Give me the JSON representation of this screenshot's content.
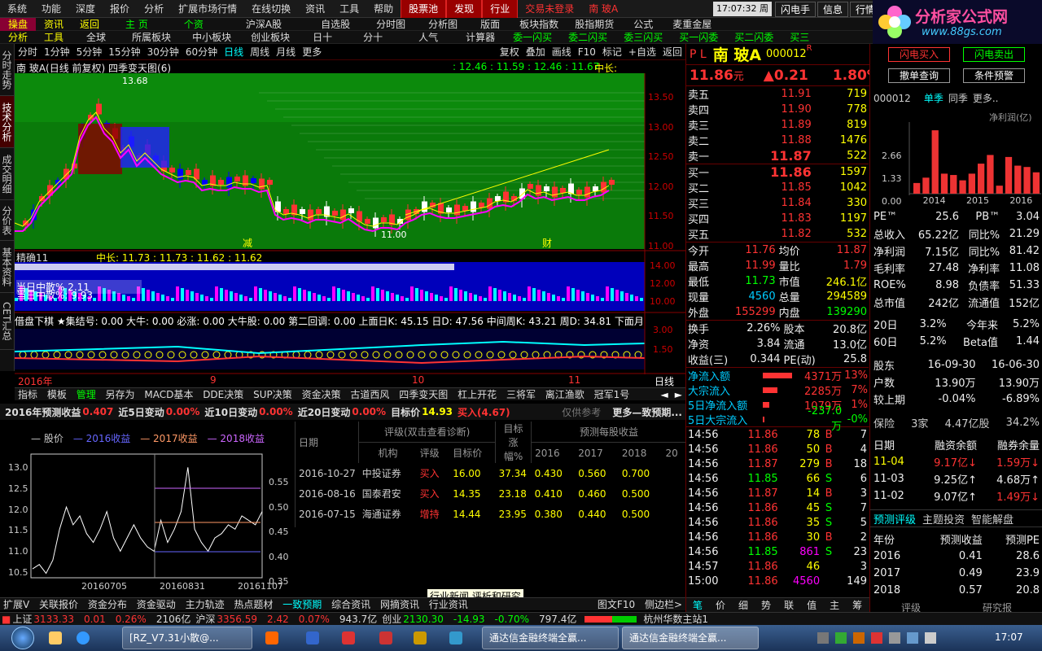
{
  "menu": {
    "items": [
      "系统",
      "功能",
      "深度",
      "报价",
      "分析",
      "扩展市场行情",
      "在线切换",
      "资讯",
      "工具",
      "帮助"
    ],
    "hot": [
      "股票池",
      "发现",
      "行业"
    ],
    "login": "交易未登录",
    "stock": "南 玻A",
    "time": "17:07:32 周一",
    "right": [
      "闪电手",
      "信息",
      "行情"
    ]
  },
  "logo": {
    "line1": "分析家公式网",
    "line2": "www.88gs.com"
  },
  "toolbar1": [
    "操盘",
    "资讯",
    "返回",
    "主 页",
    "个资",
    "沪深A股",
    "自选股",
    "分时图",
    "分析图",
    "版面",
    "板块指数",
    "股指期货",
    "公式",
    "麦重金屋"
  ],
  "toolbar2": [
    "分析",
    "工具",
    "全球",
    "所属板块",
    "中小板块",
    "创业板块",
    "日十",
    "分十",
    "人气",
    "计算器",
    "委一闪买",
    "委二闪买",
    "委三闪买",
    "买一闪委",
    "买二闪委",
    "买三"
  ],
  "periods": [
    "分时",
    "1分钟",
    "5分钟",
    "15分钟",
    "30分钟",
    "60分钟",
    "日线",
    "周线",
    "月线",
    "更多"
  ],
  "periods_right": [
    "复权",
    "叠加",
    "画线",
    "F10",
    "标记",
    "+自选",
    "返回"
  ],
  "leftnav": [
    "分时走势",
    "技术分析",
    "成交明细",
    "分价表",
    "基本资料",
    "CET汇总"
  ],
  "chart": {
    "title": "南 玻A(日线 前复权) 四季变天图(6)",
    "top_values": ": 12.46 : 11.59 : 12.46 : 11.67",
    "mid_label": "中长:",
    "high_label": "13.68",
    "low_label": "11.00",
    "mark1": "减",
    "mark2": "财",
    "yticks": [
      "13.50",
      "13.00",
      "12.50",
      "12.00",
      "11.50",
      "11.00"
    ],
    "ind1_label": "精确11",
    "ind1_values": "中长: 11.73 : 11.73 : 11.62 : 11.62",
    "ind1_text": "当日中散% 2.11",
    "ind1_text2": "当日中散%: 9.93",
    "ind1_yticks": [
      "14.00",
      "12.00",
      "10.00"
    ],
    "ind2_label": "借盘下棋 ★集结号: 0.00 大牛: 0.00 必涨: 0.00 大牛股: 0.00 第二回调: 0.00 上面日K: 45.15 日D: 47.56 中间周K: 43.21 周D: 34.81 下面月K:",
    "ind2_yticks": [
      "3.00",
      "1.50"
    ],
    "year_label": "2016年",
    "month1": "9",
    "month2": "10",
    "month3": "11",
    "period_right": "日线"
  },
  "bottom_tabs": [
    "指标",
    "模板",
    "管理",
    "另存为",
    "MACD基本",
    "DDE决策",
    "SUP决策",
    "资金决策",
    "古道西风",
    "四季变天图",
    "杠上开花",
    "三将军",
    "离江渔歌",
    "冠军1号"
  ],
  "forecast": {
    "label1": "2016年预测收益",
    "v1": "0.407",
    "label2": "近5日变动",
    "v2": "0.00%",
    "label3": "近10日变动",
    "v3": "0.00%",
    "label4": "近20日变动",
    "v4": "0.00%",
    "label5": "目标价",
    "v5": "14.93",
    "label6": "买入(4.67)",
    "note": "仅供参考",
    "more": "更多—致预期..."
  },
  "legend": [
    "股价",
    "2016收益",
    "2017收益",
    "2018收益"
  ],
  "mini_chart": {
    "yleft": [
      "13.0",
      "12.5",
      "12.0",
      "11.5",
      "11.0",
      "10.5"
    ],
    "yright": [
      "0.55",
      "0.50",
      "0.45",
      "0.40",
      "0.35"
    ],
    "xlabels": [
      "20160705",
      "20160831",
      "20161107"
    ]
  },
  "reports": {
    "h_date": "日期",
    "h_rating": "评级(双击查看诊断)",
    "h_target": "目标涨幅%",
    "h_eps": "预测每股收益",
    "h_org": "机构",
    "h_grade": "评级",
    "h_price": "目标价",
    "years": [
      "2016",
      "2017",
      "2018",
      "20"
    ],
    "rows": [
      {
        "date": "2016-10-27",
        "org": "中投证券",
        "grade": "买入",
        "price": "16.00",
        "gain": "37.34",
        "e1": "0.430",
        "e2": "0.560",
        "e3": "0.700"
      },
      {
        "date": "2016-08-16",
        "org": "国泰君安",
        "grade": "买入",
        "price": "14.35",
        "gain": "23.18",
        "e1": "0.410",
        "e2": "0.460",
        "e3": "0.500"
      },
      {
        "date": "2016-07-15",
        "org": "海通证券",
        "grade": "增持",
        "price": "14.44",
        "gain": "23.95",
        "e1": "0.380",
        "e2": "0.440",
        "e3": "0.500"
      }
    ]
  },
  "tooltip": "行业新闻,评析和研究",
  "info_tabs": [
    "扩展V",
    "关联报价",
    "资金分布",
    "资金驱动",
    "主力轨迹",
    "热点题材",
    "一致预期",
    "综合资讯",
    "网摘资讯",
    "行业资讯"
  ],
  "info_right": [
    "图文F10",
    "侧边栏>"
  ],
  "quote": {
    "prefix": "P L",
    "name": "南 玻A",
    "code": "000012",
    "r": "R",
    "price": "11.86",
    "unit": "元",
    "change": "▲0.21",
    "pct": "1.80%",
    "sells": [
      {
        "l": "卖五",
        "p": "11.91",
        "v": "719"
      },
      {
        "l": "卖四",
        "p": "11.90",
        "v": "778"
      },
      {
        "l": "卖三",
        "p": "11.89",
        "v": "819"
      },
      {
        "l": "卖二",
        "p": "11.88",
        "v": "1476"
      },
      {
        "l": "卖一",
        "p": "11.87",
        "v": "522"
      }
    ],
    "buys": [
      {
        "l": "买一",
        "p": "11.86",
        "v": "1597"
      },
      {
        "l": "买二",
        "p": "11.85",
        "v": "1042"
      },
      {
        "l": "买三",
        "p": "11.84",
        "v": "330"
      },
      {
        "l": "买四",
        "p": "11.83",
        "v": "1197"
      },
      {
        "l": "买五",
        "p": "11.82",
        "v": "532"
      }
    ],
    "stats": [
      [
        "今开",
        "11.76",
        "均价",
        "11.87"
      ],
      [
        "最高",
        "11.99",
        "量比",
        "1.79"
      ],
      [
        "最低",
        "11.73",
        "市值",
        "246.1亿"
      ],
      [
        "现量",
        "4560",
        "总量",
        "294589"
      ],
      [
        "外盘",
        "155299",
        "内盘",
        "139290"
      ]
    ],
    "stats2": [
      [
        "换手",
        "2.26%",
        "股本",
        "20.8亿"
      ],
      [
        "净资",
        "3.84",
        "流通",
        "13.0亿"
      ],
      [
        "收益(三)",
        "0.344",
        "PE(动)",
        "25.8"
      ]
    ],
    "flows": [
      {
        "l": "净流入额",
        "v": "4371万",
        "p": "13%",
        "bar": 0.9
      },
      {
        "l": "大宗流入",
        "v": "2285万",
        "p": "7%",
        "bar": 0.45
      },
      {
        "l": "5日净流入额",
        "v": "1079万",
        "p": "1%",
        "bar": 0.2
      },
      {
        "l": "5日大宗流入",
        "v": "-237.0万",
        "p": "-0%",
        "bar": 0.05
      }
    ],
    "ticks": [
      [
        "14:56",
        "11.86",
        "78",
        "B",
        "7"
      ],
      [
        "14:56",
        "11.86",
        "50",
        "B",
        "4"
      ],
      [
        "14:56",
        "11.87",
        "279",
        "B",
        "18"
      ],
      [
        "14:56",
        "11.85",
        "66",
        "S",
        "6"
      ],
      [
        "14:56",
        "11.87",
        "14",
        "B",
        "3"
      ],
      [
        "14:56",
        "11.86",
        "45",
        "S",
        "7"
      ],
      [
        "14:56",
        "11.86",
        "35",
        "S",
        "5"
      ],
      [
        "14:56",
        "11.86",
        "30",
        "B",
        "2"
      ],
      [
        "14:56",
        "11.85",
        "861",
        "S",
        "23"
      ],
      [
        "14:57",
        "11.86",
        "46",
        "",
        "3"
      ],
      [
        "15:00",
        "11.86",
        "4560",
        "",
        "149"
      ]
    ],
    "tick_tabs": [
      "笔",
      "价",
      "细",
      "势",
      "联",
      "值",
      "主",
      "筹"
    ]
  },
  "rightpanel": {
    "btn1": "闪电买入",
    "btn2": "闪电卖出",
    "btn3": "撤单查询",
    "btn4": "条件预警",
    "code": "000012",
    "tab1": "单季",
    "tab2": "同季",
    "tab3": "更多..",
    "chart_label": "净利润(亿)",
    "years": [
      "2014",
      "2015",
      "2016"
    ],
    "yticks": [
      "2.66",
      "1.33",
      "0.00"
    ],
    "bars": [
      0.16,
      0.24,
      0.95,
      0.3,
      0.28,
      0.2,
      0.3,
      0.45,
      0.58,
      0.12,
      0.55,
      0.42,
      0.4,
      0.32
    ],
    "fin": [
      [
        "PE™",
        "25.6",
        "PB™",
        "3.04"
      ],
      [
        "总收入",
        "65.22亿",
        "同比%",
        "21.29"
      ],
      [
        "净利润",
        "7.15亿",
        "同比%",
        "81.42"
      ],
      [
        "毛利率",
        "27.48",
        "净利率",
        "11.08"
      ],
      [
        "ROE%",
        "8.98",
        "负债率",
        "51.33"
      ],
      [
        "总市值",
        "242亿",
        "流通值",
        "152亿"
      ]
    ],
    "perf": [
      [
        "20日",
        "3.2%",
        "今年来",
        "5.2%"
      ],
      [
        "60日",
        "5.2%",
        "Beta值",
        "1.44"
      ]
    ],
    "holders": [
      [
        "股东",
        "16-09-30",
        "16-06-30"
      ],
      [
        "户数",
        "13.90万",
        "13.90万"
      ],
      [
        "较上期",
        "-0.04%",
        "-6.89%"
      ]
    ],
    "insure": [
      "保险",
      "3家",
      "4.47亿股",
      "34.2%"
    ],
    "margin_head": [
      "日期",
      "融资余额",
      "融券余量"
    ],
    "margin": [
      [
        "11-04",
        "9.17亿↓",
        "1.59万↓"
      ],
      [
        "11-03",
        "9.25亿↑",
        "4.68万↑"
      ],
      [
        "11-02",
        "9.07亿↑",
        "1.49万↓"
      ]
    ],
    "eps_tabs": [
      "预测评级",
      "主题投资",
      "智能解盘"
    ],
    "eps_head": [
      "年份",
      "预测收益",
      "预测PE"
    ],
    "eps": [
      [
        "2016",
        "0.41",
        "28.6"
      ],
      [
        "2017",
        "0.49",
        "23.9"
      ],
      [
        "2018",
        "0.57",
        "20.8"
      ]
    ],
    "eps_more": [
      "评级",
      "研究报"
    ]
  },
  "status": {
    "sh_label": "上证",
    "sh": "3133.33",
    "sh_ch": "0.01",
    "sh_pct": "0.26%",
    "sh_vol": "2106亿",
    "hs_label": "沪深",
    "hs": "3356.59",
    "hs_ch": "2.42",
    "hs_pct": "0.07%",
    "hs_vol": "943.7亿",
    "cy_label": "创业",
    "cy": "2130.30",
    "cy_ch": "-14.93",
    "cy_pct": "-0.70%",
    "cy_vol": "797.4亿",
    "server": "杭州华数主站1"
  },
  "taskbar": {
    "t1": "[RZ_V7.31小散@...",
    "t2": "通达信金融终端全赢...",
    "t3": "通达信金融终端全赢...",
    "clock": "17:07"
  }
}
